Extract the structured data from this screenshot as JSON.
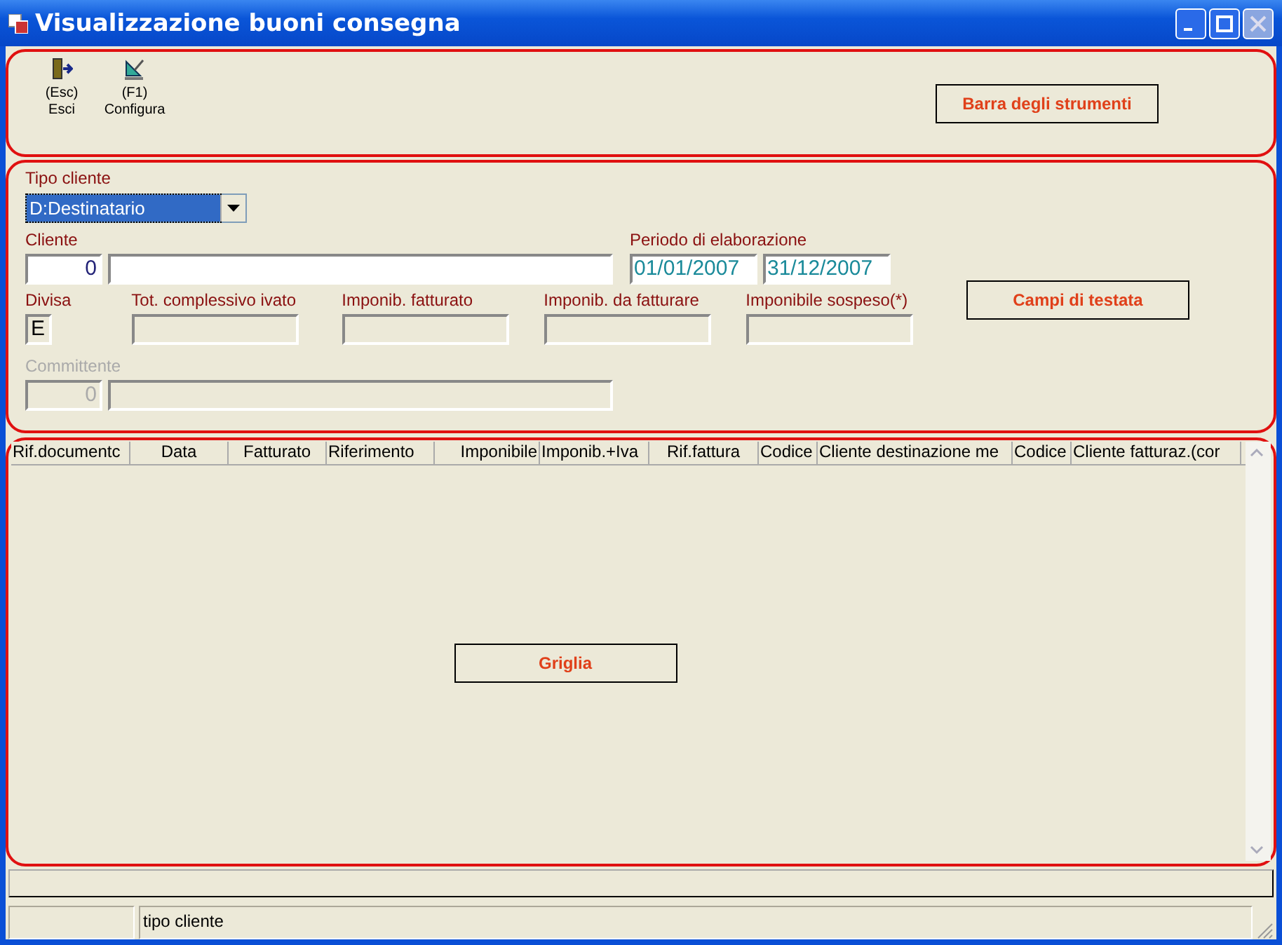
{
  "window": {
    "title": "Visualizzazione buoni consegna"
  },
  "toolbar": {
    "buttons": [
      {
        "kind": "exit",
        "key": "(Esc)",
        "label": "Esci"
      },
      {
        "kind": "configure",
        "key": "(F1)",
        "label": "Configura"
      }
    ],
    "annotation": "Barra degli strumenti"
  },
  "header": {
    "tipo_cliente": {
      "label": "Tipo cliente",
      "value": "D:Destinatario",
      "focused": true
    },
    "cliente": {
      "label": "Cliente",
      "code": "0",
      "disabled": false
    },
    "periodo": {
      "label": "Periodo di elaborazione",
      "from": "01/01/2007",
      "to": "31/12/2007"
    },
    "totals": [
      {
        "label": "Divisa",
        "value": "E"
      },
      {
        "label": "Tot. complessivo ivato"
      },
      {
        "label": "Imponib. fatturato"
      },
      {
        "label": "Imponib. da fatturare"
      },
      {
        "label": "Imponibile sospeso(*)"
      }
    ],
    "committente": {
      "label": "Committente",
      "code": "0",
      "disabled": true
    },
    "annotation": "Campi di testata"
  },
  "table": {
    "columns": [
      "Rif.documentc",
      "Data",
      "Fatturato",
      "Riferimento",
      "Imponibile",
      "Imponib.+Iva",
      "Rif.fattura",
      "Codice",
      "Cliente destinazione me",
      "Codice",
      "Cliente fatturaz.(cor"
    ],
    "annotation": "Griglia"
  },
  "status_bar": {
    "panels": [
      "tipo cliente"
    ]
  }
}
